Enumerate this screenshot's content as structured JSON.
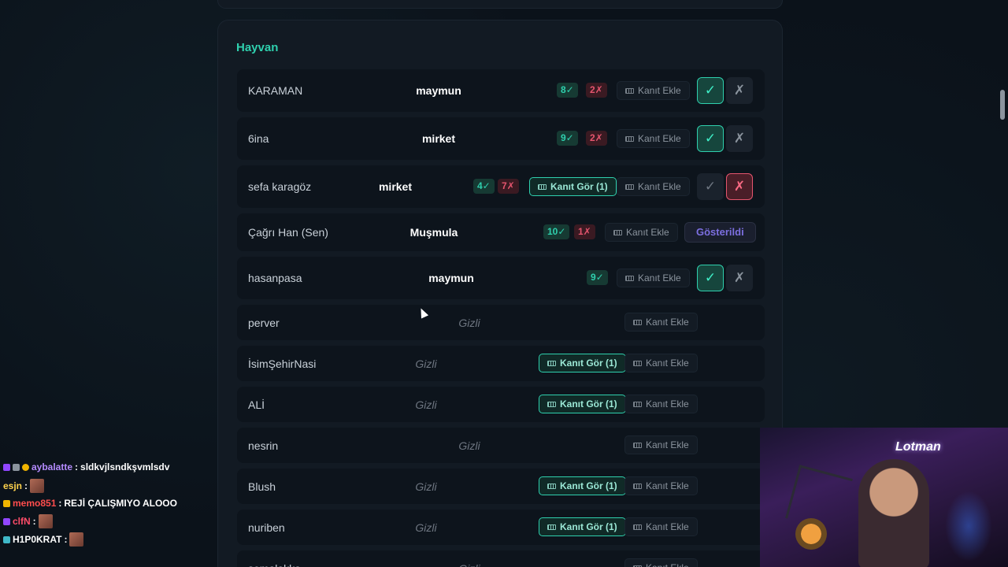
{
  "panel": {
    "title": "Hayvan"
  },
  "labels": {
    "add_proof": "Kanıt Ekle",
    "view_proof": "Kanıt Gör (1)",
    "hidden": "Gizli",
    "shown": "Gösterildi",
    "approve": "✓",
    "reject": "✗"
  },
  "rows": [
    {
      "name": "KARAMAN",
      "word": "maymun",
      "yes": "8✓",
      "no": "2✗"
    },
    {
      "name": "6ina",
      "word": "mirket",
      "yes": "9✓",
      "no": "2✗"
    },
    {
      "name": "sefa karagöz",
      "word": "mirket",
      "yes": "4✓",
      "no": "7✗"
    },
    {
      "name": "Çağrı Han (Sen)",
      "word": "Muşmula",
      "yes": "10✓",
      "no": "1✗"
    },
    {
      "name": "hasanpasa",
      "word": "maymun",
      "yes": "9✓"
    },
    {
      "name": "perver"
    },
    {
      "name": "İsimŞehirNasi"
    },
    {
      "name": "ALİ"
    },
    {
      "name": "nesrin"
    },
    {
      "name": "Blush"
    },
    {
      "name": "nuriben"
    },
    {
      "name": "semalakka"
    }
  ],
  "chat": [
    {
      "user": "aybalatte",
      "message": "sldkvjlsndkşvmlsdv",
      "color": "#b58cff"
    },
    {
      "user": "esjn",
      "message": "",
      "color": "#ffd34d"
    },
    {
      "user": "memo851",
      "message": "REJİ ÇALIŞMIYO ALOOO",
      "color": "#ff4d4d"
    },
    {
      "user": "clfN",
      "message": "",
      "color": "#ff4d6a"
    },
    {
      "user": "H1P0KRAT",
      "message": "",
      "color": "#ffffff"
    }
  ],
  "webcam": {
    "sign_text": "Lotman"
  },
  "colors": {
    "accent": "#2fd0ae",
    "danger": "#e5556e",
    "shown": "#7c6fe0"
  }
}
